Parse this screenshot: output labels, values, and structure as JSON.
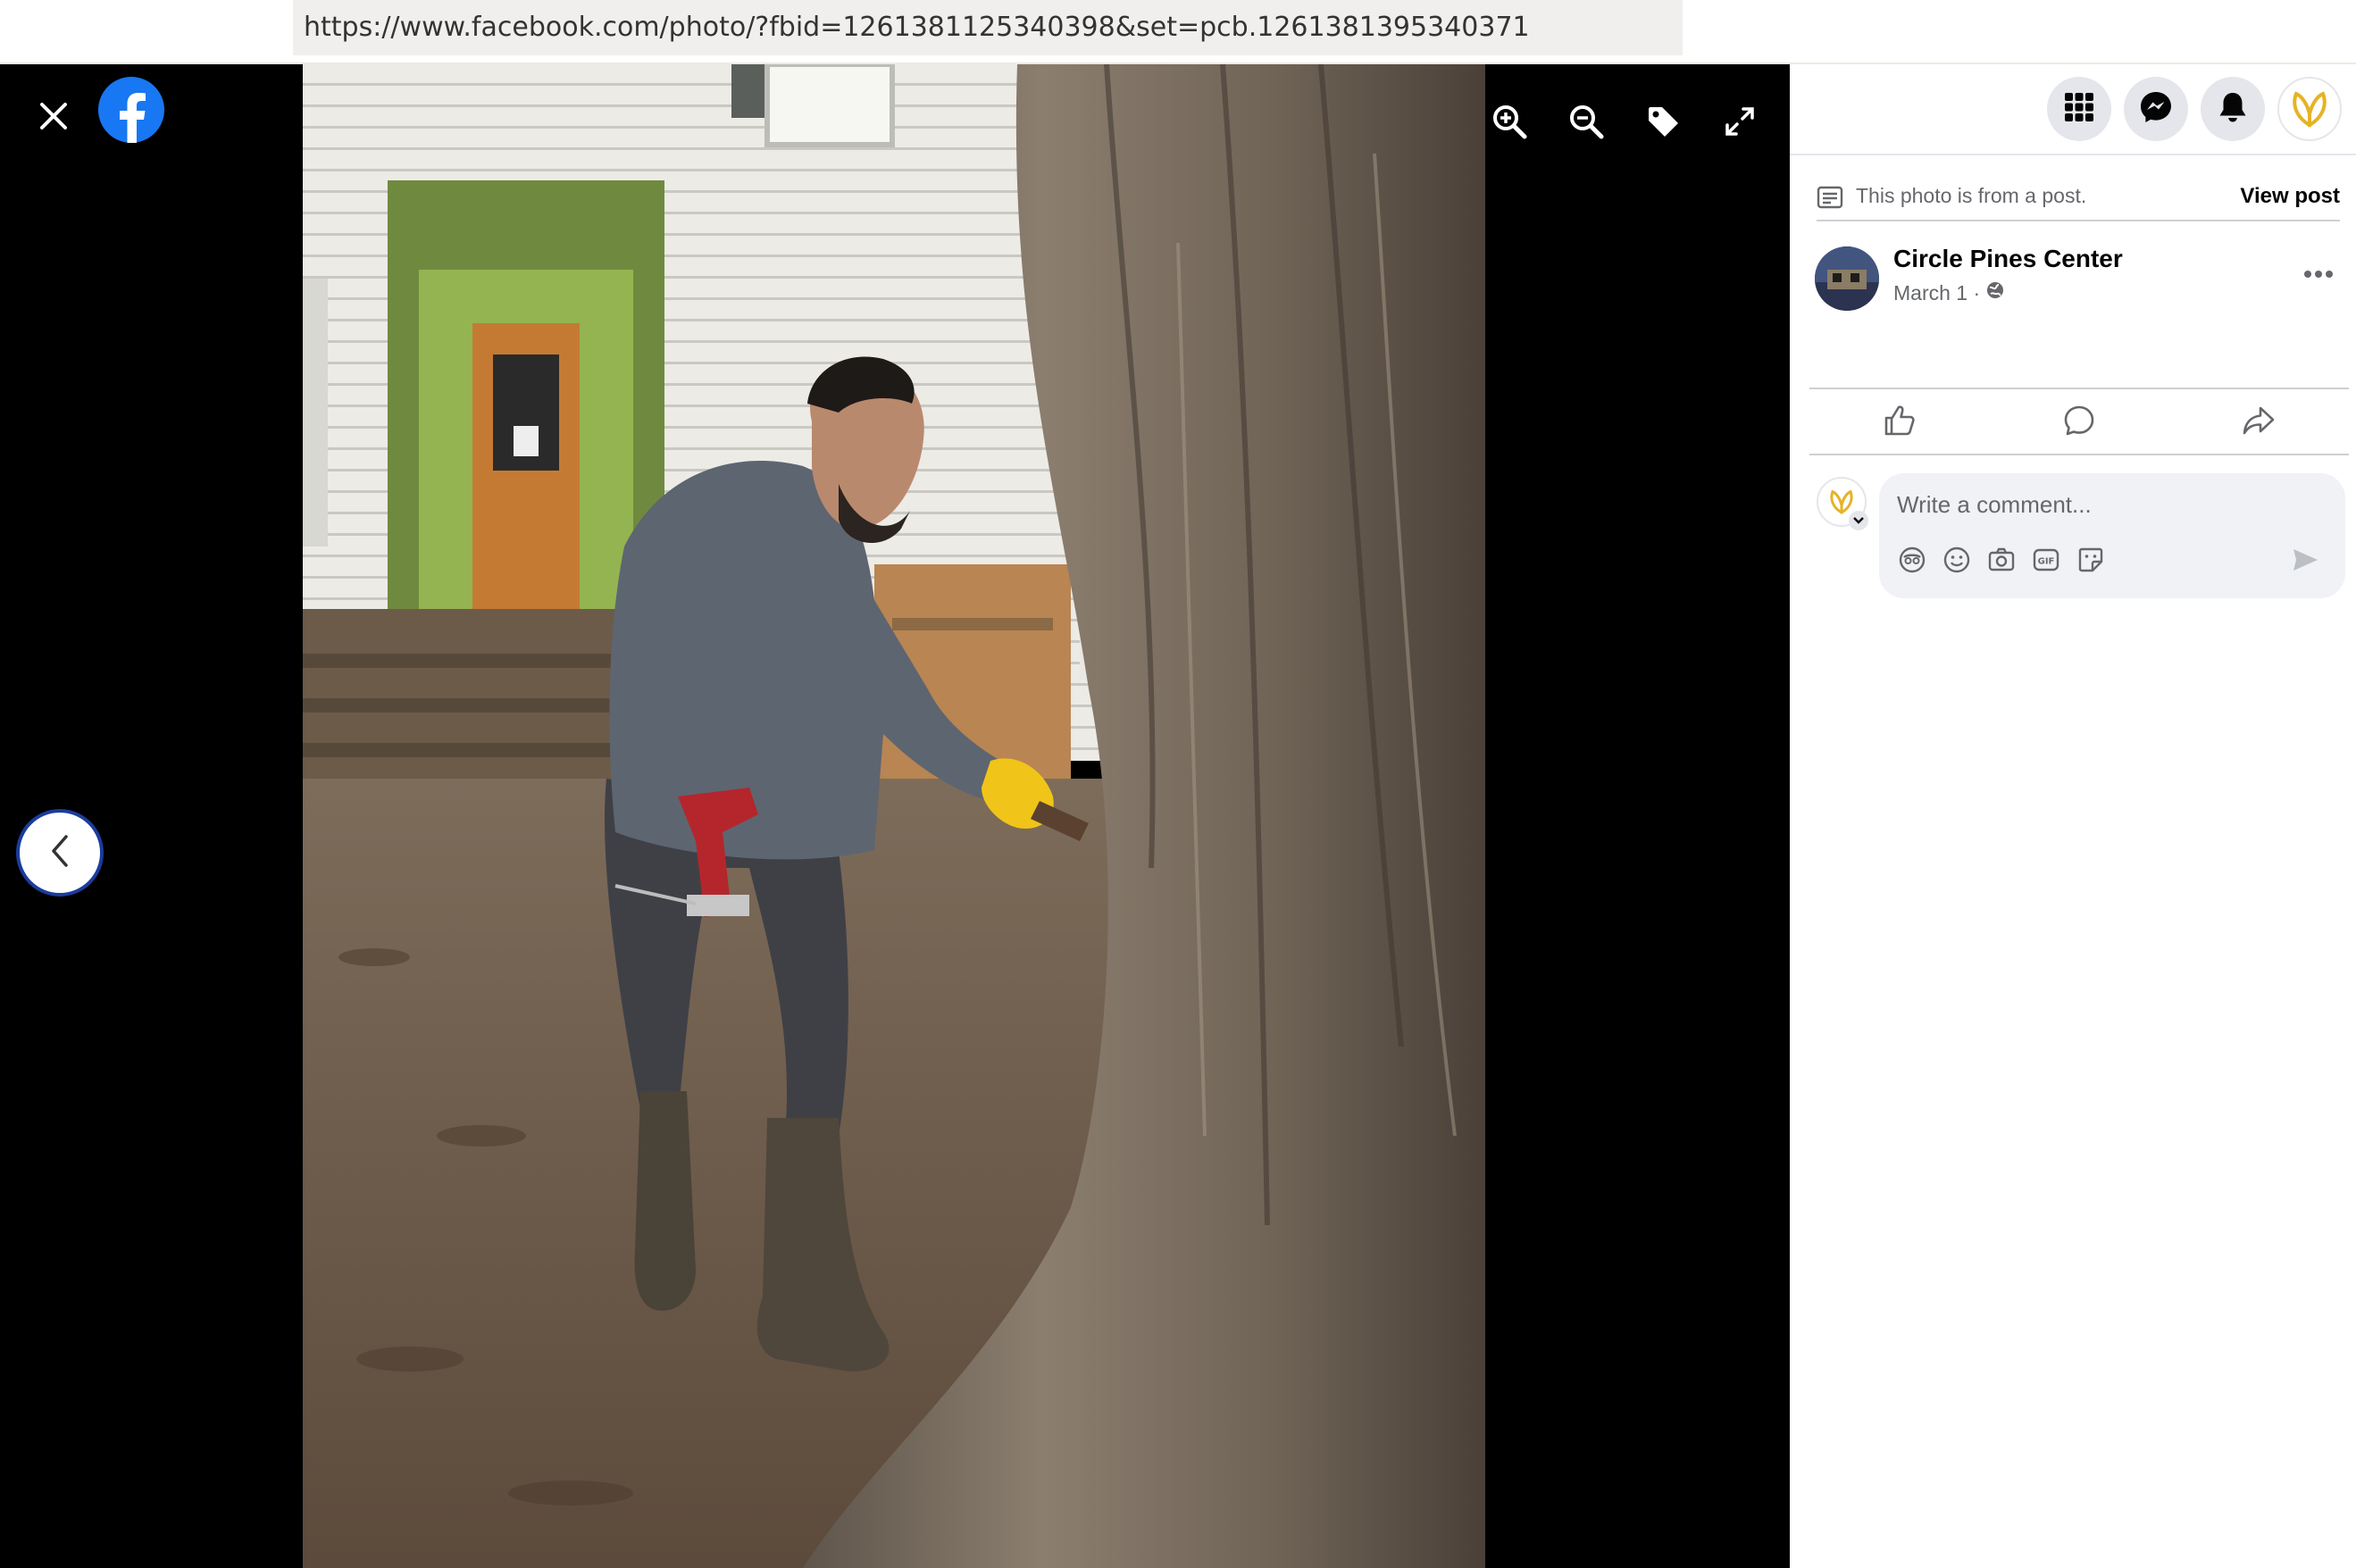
{
  "browser": {
    "url": "https://www.facebook.com/photo/?fbid=1261381125340398&set=pcb.1261381395340371"
  },
  "viewer": {
    "icons": {
      "close": "close-icon",
      "logo": "facebook-logo",
      "previous": "chevron-left-icon",
      "zoom_in": "zoom-in-icon",
      "zoom_out": "zoom-out-icon",
      "tag": "tag-icon",
      "fullscreen": "expand-icon"
    },
    "photo_subject": "man with drill and yellow glove tapping a large tree trunk in front of a white house with green door frame"
  },
  "header": {
    "buttons": [
      "menu-grid-icon",
      "messenger-icon",
      "notifications-bell-icon",
      "account-avatar"
    ]
  },
  "post": {
    "note": "This photo is from a post.",
    "view_post_label": "View post",
    "page_name": "Circle Pines Center",
    "date": "March 1 ·",
    "privacy_icon": "globe-icon"
  },
  "actions": [
    "like-icon",
    "comment-icon",
    "share-icon"
  ],
  "comment": {
    "placeholder": "Write a comment...",
    "icons": [
      "avatar-sticker-icon",
      "emoji-icon",
      "camera-icon",
      "gif-icon",
      "sticker-icon",
      "send-icon"
    ]
  },
  "colors": {
    "accent": "#1877f2",
    "viewer_bg": "#000000",
    "panel_bg": "#ffffff",
    "muted_text": "#65676b",
    "comment_bg": "#f0f2f5"
  }
}
